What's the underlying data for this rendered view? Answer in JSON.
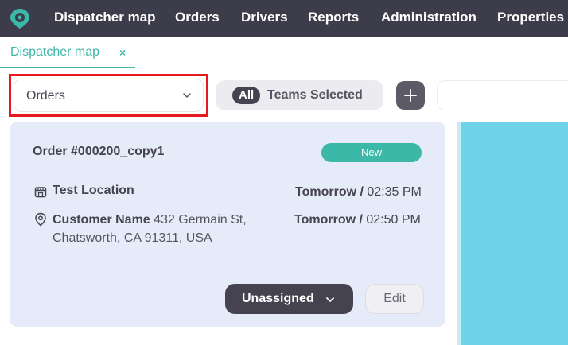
{
  "nav": {
    "items": [
      "Dispatcher map",
      "Orders",
      "Drivers",
      "Reports",
      "Administration",
      "Properties"
    ]
  },
  "tabs": [
    {
      "label": "Dispatcher map",
      "close": "×"
    }
  ],
  "toolbar": {
    "view_select": {
      "value": "Orders"
    },
    "teams": {
      "pill": "All",
      "label": "Teams Selected"
    },
    "add_label": "+"
  },
  "order": {
    "title": "Order #000200_copy1",
    "status": "New",
    "pickup": {
      "location": "Test Location",
      "day": "Tomorrow /",
      "time": "02:35 PM"
    },
    "dropoff": {
      "customer": "Customer Name",
      "address": "432 Germain St, Chatsworth, CA 91311, USA",
      "day": "Tomorrow /",
      "time": "02:50 PM"
    },
    "assign_label": "Unassigned",
    "edit_label": "Edit"
  },
  "colors": {
    "nav_bg": "#3d3c4a",
    "accent": "#3bb8a8",
    "card_bg": "#e6ebfa",
    "highlight": "#e8181f",
    "map_water": "#6ed3e9"
  },
  "icons": [
    "logo-pin-icon",
    "chevron-down-icon",
    "plus-icon",
    "store-icon",
    "location-pin-icon"
  ]
}
